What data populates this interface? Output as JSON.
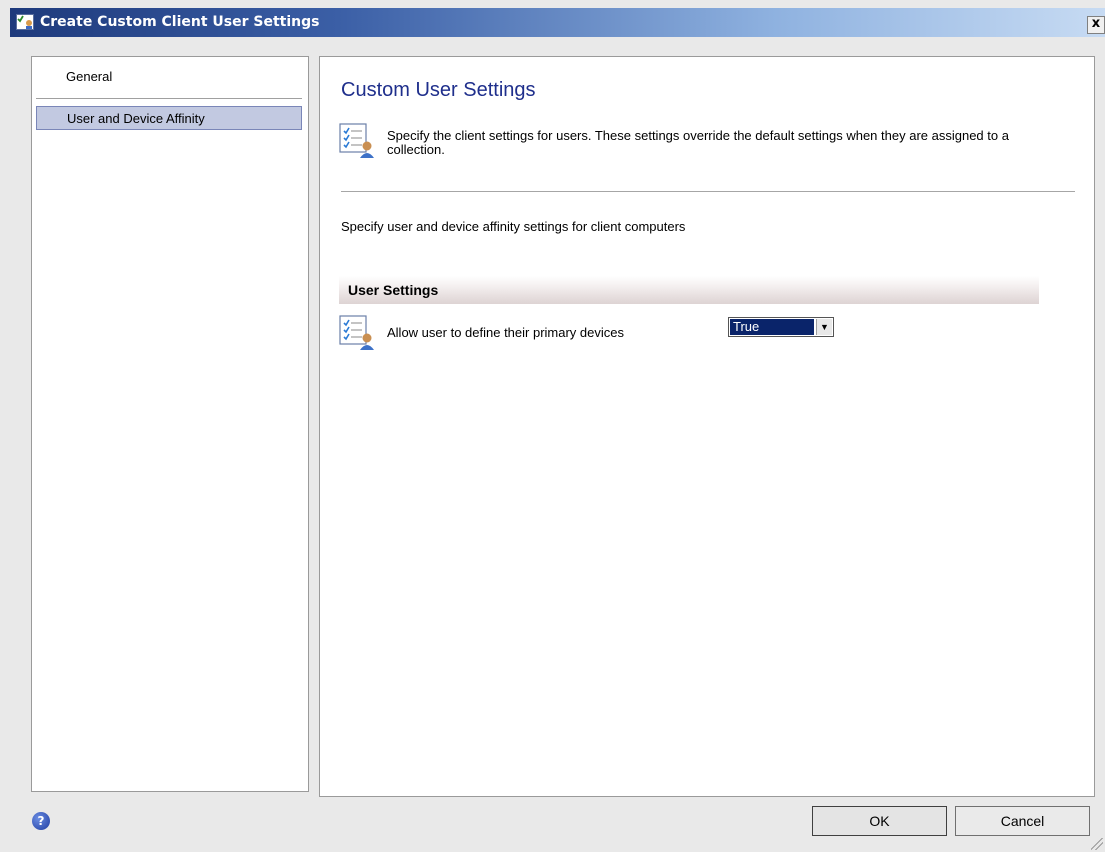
{
  "window": {
    "title": "Create Custom Client User Settings",
    "close_label": "x"
  },
  "nav": {
    "items": [
      {
        "label": "General",
        "selected": false
      },
      {
        "label": "User and Device Affinity",
        "selected": true
      }
    ]
  },
  "content": {
    "page_title": "Custom User Settings",
    "header_description": "Specify the client settings for users. These settings override the default settings when they are assigned to a collection.",
    "section_description": "Specify user and device affinity settings for client computers",
    "group_title": "User Settings",
    "settings": [
      {
        "label": "Allow user to define their primary devices",
        "value": "True"
      }
    ]
  },
  "footer": {
    "help_icon": "help-icon",
    "ok_label": "OK",
    "cancel_label": "Cancel"
  },
  "colors": {
    "title_accent": "#1f2f8c",
    "selection": "#c2c9e1",
    "dropdown_highlight": "#0a246a"
  }
}
